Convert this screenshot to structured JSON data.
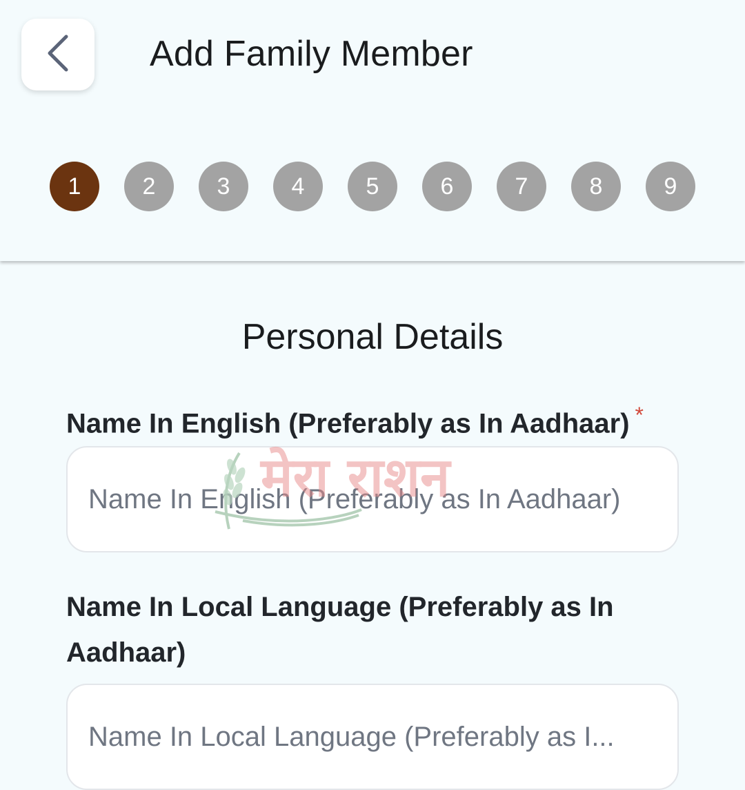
{
  "header": {
    "title": "Add Family Member",
    "steps": [
      "1",
      "2",
      "3",
      "4",
      "5",
      "6",
      "7",
      "8",
      "9"
    ],
    "active_step": 1
  },
  "form": {
    "section_title": "Personal Details",
    "name_english": {
      "label": "Name In English (Preferably as In Aadhaar)",
      "required_mark": "*",
      "placeholder": "Name In English (Preferably as In Aadhaar)",
      "value": ""
    },
    "name_local": {
      "label": "Name In Local Language (Preferably as In Aadhaar)",
      "placeholder": "Name In Local Language (Preferably as I...",
      "value": ""
    }
  },
  "watermark": {
    "text": "मेरा राशन"
  },
  "icons": {
    "back": "chevron-left-icon",
    "watermark_logo": "wheat-icon"
  },
  "colors": {
    "background": "#f4fbfd",
    "step_active": "#6b3410",
    "step_inactive": "#a3a3a3",
    "required": "#d24a3c",
    "watermark_text": "#e88a8a",
    "watermark_logo": "#9fc4a8"
  }
}
